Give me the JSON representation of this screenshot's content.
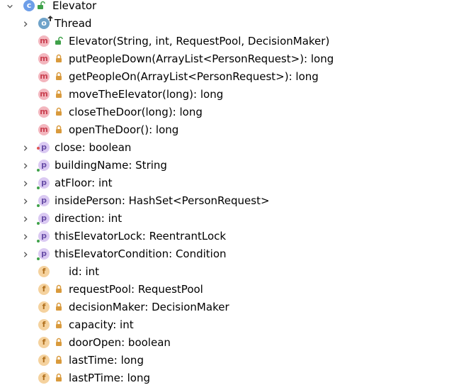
{
  "tree": {
    "root": {
      "badge": "c",
      "name": "Elevator"
    },
    "parent": {
      "badge": "o",
      "name": "Thread"
    },
    "methods": [
      {
        "badge": "m",
        "access": "public",
        "label": "Elevator(String, int, RequestPool, DecisionMaker)"
      },
      {
        "badge": "m",
        "access": "private",
        "label": "putPeopleDown(ArrayList<PersonRequest>): long"
      },
      {
        "badge": "m",
        "access": "private",
        "label": "getPeopleOn(ArrayList<PersonRequest>): long"
      },
      {
        "badge": "m",
        "access": "private",
        "label": "moveTheElevator(long): long"
      },
      {
        "badge": "m",
        "access": "private",
        "label": "closeTheDoor(long): long"
      },
      {
        "badge": "m",
        "access": "private",
        "label": "openTheDoor(): long"
      }
    ],
    "properties": [
      {
        "badge": "p",
        "dot": "red",
        "name": "close",
        "type": ": boolean"
      },
      {
        "badge": "p",
        "dot": "green",
        "name": "buildingName",
        "type": ": String"
      },
      {
        "badge": "p",
        "dot": "green",
        "name": "atFloor",
        "type": ": int"
      },
      {
        "badge": "p",
        "dot": "green",
        "name": "insidePerson",
        "type": ": HashSet<PersonRequest>"
      },
      {
        "badge": "p",
        "dot": "green",
        "name": "direction",
        "type": ": int"
      },
      {
        "badge": "p",
        "dot": "green",
        "name": "thisElevatorLock",
        "type": ": ReentrantLock"
      },
      {
        "badge": "p",
        "dot": "green",
        "name": "thisElevatorCondition",
        "type": ": Condition"
      }
    ],
    "fields": [
      {
        "badge": "f",
        "access": "package",
        "label": "id: int"
      },
      {
        "badge": "f",
        "access": "private",
        "label": "requestPool: RequestPool"
      },
      {
        "badge": "f",
        "access": "private",
        "label": "decisionMaker: DecisionMaker"
      },
      {
        "badge": "f",
        "access": "private",
        "label": "capacity: int"
      },
      {
        "badge": "f",
        "access": "private",
        "label": "doorOpen: boolean"
      },
      {
        "badge": "f",
        "access": "private",
        "label": "lastTime: long"
      },
      {
        "badge": "f",
        "access": "private",
        "label": "lastPTime: long"
      }
    ]
  },
  "colors": {
    "public": "#3fa14a",
    "private": "#d99a3c",
    "chevron": "#555555",
    "typeText": "#000000"
  }
}
